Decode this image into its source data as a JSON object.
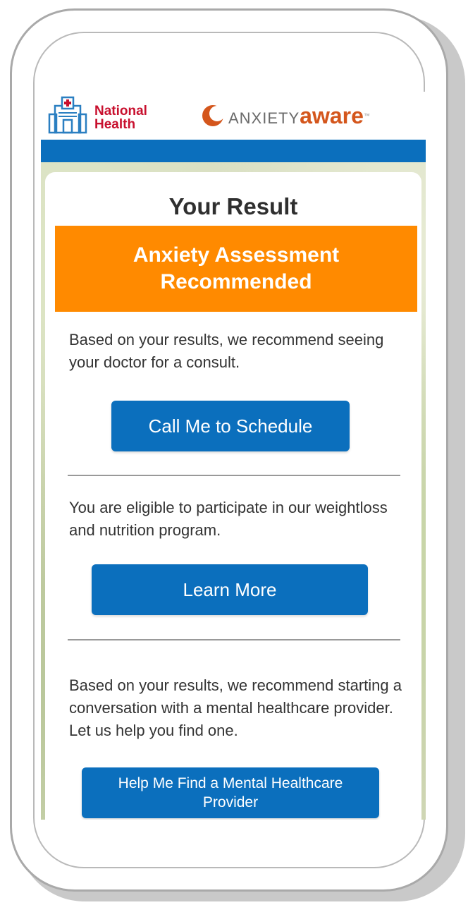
{
  "header": {
    "left_logo": {
      "line1": "National",
      "line2": "Health"
    },
    "right_logo": {
      "part1": "ANXIETY",
      "part2": "aware",
      "tm": "™"
    }
  },
  "result": {
    "title": "Your Result",
    "banner": "Anxiety Assessment Recommended"
  },
  "sections": [
    {
      "text": "Based on your results, we recommend seeing your doctor for a consult.",
      "button": "Call Me to Schedule"
    },
    {
      "text": "You are eligible to participate in our weightloss and nutrition program.",
      "button": "Learn More"
    },
    {
      "text": "Based on your results, we recommend starting a conversation with a mental healthcare provider. Let us help you find one.",
      "button": "Help Me Find a Mental Healthcare Provider"
    }
  ],
  "colors": {
    "primary_blue": "#0b6fbd",
    "banner_orange": "#ff8a00",
    "brand_red": "#c8102e",
    "aware_orange": "#d4561c"
  }
}
